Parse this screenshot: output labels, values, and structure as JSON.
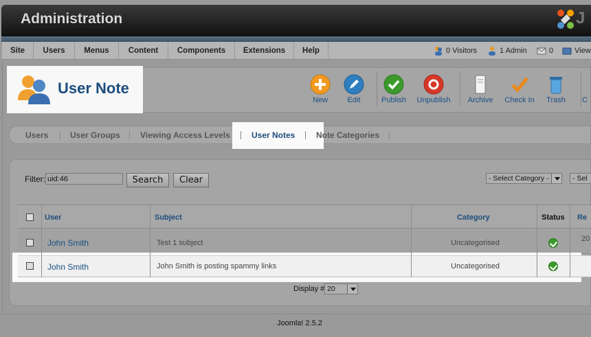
{
  "header": {
    "title": "Administration",
    "logo_letter": "J"
  },
  "menu": {
    "items": [
      "Site",
      "Users",
      "Menus",
      "Content",
      "Components",
      "Extensions",
      "Help"
    ]
  },
  "status": {
    "visitors": "0 Visitors",
    "admins": "1 Admin",
    "messages": "0",
    "view": "View"
  },
  "page": {
    "title": "User Note",
    "icon": "users-icon"
  },
  "toolbar": {
    "new": "New",
    "edit": "Edit",
    "publish": "Publish",
    "unpublish": "Unpublish",
    "archive": "Archive",
    "checkin": "Check In",
    "trash": "Trash",
    "more": "C"
  },
  "subtabs": {
    "items": [
      "Users",
      "User Groups",
      "Viewing Access Levels",
      "User Notes",
      "Note Categories"
    ],
    "active": "User Notes"
  },
  "filter": {
    "label": "Filter:",
    "value": "uid:46",
    "search_label": "Search",
    "clear_label": "Clear",
    "category_select": "- Select Category -",
    "second_select": "- Sel"
  },
  "table": {
    "headers": {
      "user": "User",
      "subject": "Subject",
      "category": "Category",
      "status": "Status",
      "review": "Re"
    },
    "rows": [
      {
        "user": "John Smith",
        "subject": "Test 1 subject",
        "category": "Uncategorised",
        "status": "published",
        "review": "20"
      },
      {
        "user": "John Smith",
        "subject": "John Smith is posting spammy links",
        "category": "Uncategorised",
        "status": "published",
        "review": ""
      }
    ]
  },
  "pagination": {
    "display_label": "Display #",
    "display_value": "20"
  },
  "footer": {
    "version": "Joomla! 2.5.2"
  },
  "colors": {
    "link_blue": "#1a4f86",
    "title_blue": "#1d4d7d",
    "status_green": "#3c9a2d"
  }
}
